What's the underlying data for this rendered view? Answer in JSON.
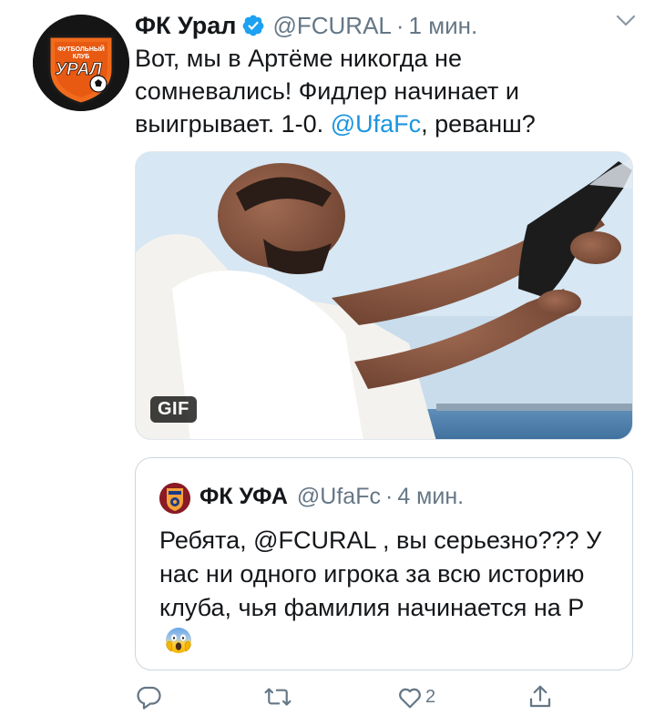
{
  "tweet": {
    "author_name": "ФК Урал",
    "author_handle": "@FCURAL",
    "separator": "·",
    "timestamp": "1 мин.",
    "text_before": "Вот, мы в Артёме никогда не сомневались! Фидлер начинает и выигрывает. 1-0. ",
    "mention": "@UfaFc",
    "text_after": ", реванш?",
    "media_badge": "GIF",
    "avatar_logo_text_top": "ФУТБОЛЬНЫЙ КЛУБ",
    "avatar_logo_text_main": "УРАЛ"
  },
  "quote": {
    "author_name": "ФК УФА",
    "author_handle": "@UfaFc",
    "separator": "·",
    "timestamp": "4 мин.",
    "text": "Ребята, @FCURAL , вы серьезно??? У нас ни одного игрока за всю историю клуба, чья фамилия начинается на Р",
    "emoji": "screaming-face"
  },
  "actions": {
    "reply_icon": "reply-icon",
    "retweet_icon": "retweet-icon",
    "like_icon": "like-icon",
    "like_count": "2",
    "share_icon": "share-icon"
  },
  "colors": {
    "link": "#1b95e0",
    "secondary_text": "#657786",
    "verified": "#1da1f2",
    "brand_orange": "#f26b1d"
  }
}
